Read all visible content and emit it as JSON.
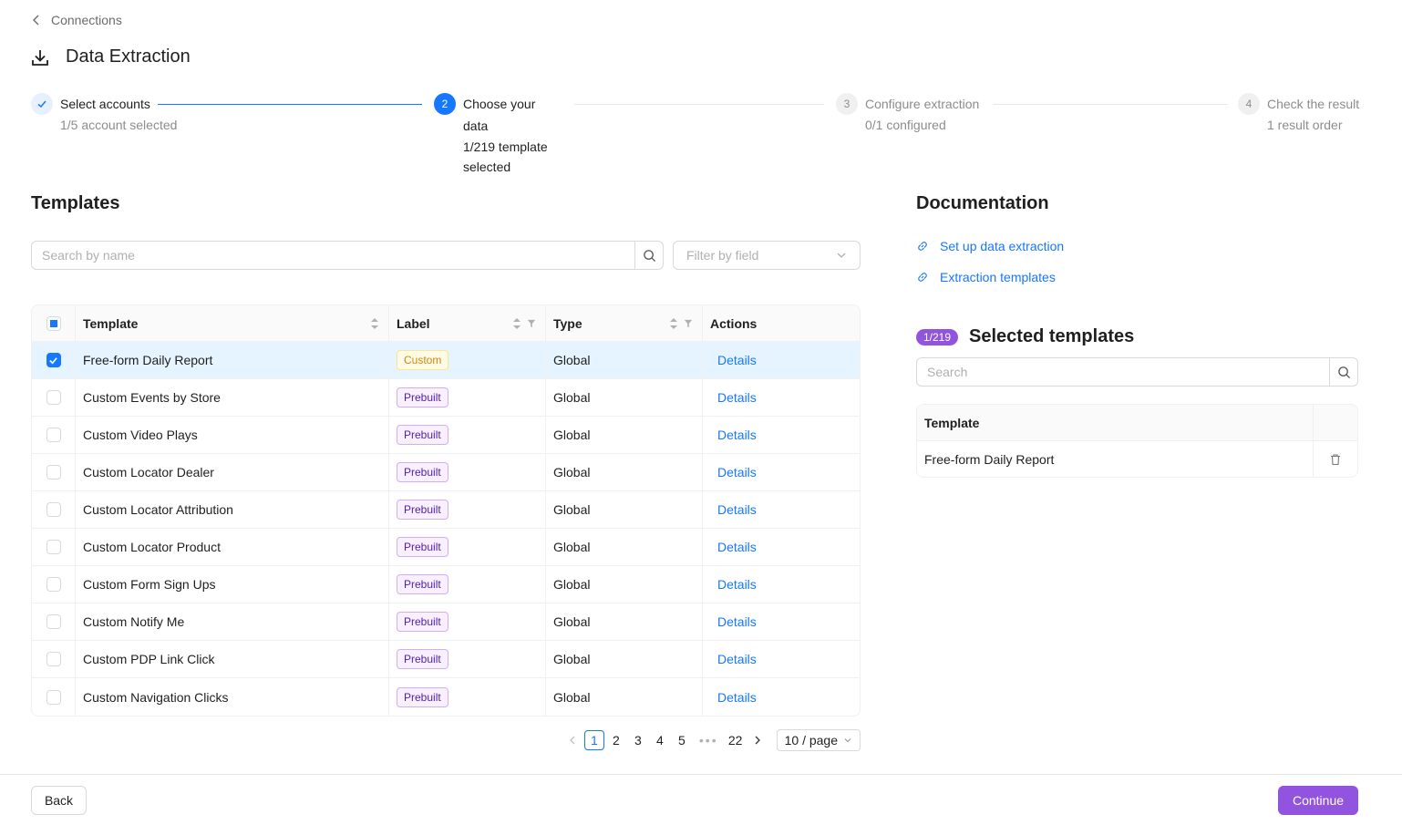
{
  "breadcrumb": {
    "back_label": "Connections"
  },
  "page": {
    "title": "Data Extraction"
  },
  "steps": [
    {
      "number": "1",
      "title": "Select accounts",
      "subtitle": "1/5 account selected",
      "status": "done"
    },
    {
      "number": "2",
      "title": "Choose your data",
      "subtitle": "1/219 template selected",
      "status": "active"
    },
    {
      "number": "3",
      "title": "Configure extraction",
      "subtitle": "0/1 configured",
      "status": "wait"
    },
    {
      "number": "4",
      "title": "Check the result",
      "subtitle": "1 result order",
      "status": "wait"
    }
  ],
  "templates": {
    "title": "Templates",
    "search_placeholder": "Search by name",
    "filter_placeholder": "Filter by field",
    "columns": {
      "template": "Template",
      "label": "Label",
      "type": "Type",
      "actions": "Actions"
    },
    "rows": [
      {
        "name": "Free-form Daily Report",
        "label": "Custom",
        "type": "Global",
        "action": "Details",
        "selected": true
      },
      {
        "name": "Custom Events by Store",
        "label": "Prebuilt",
        "type": "Global",
        "action": "Details",
        "selected": false
      },
      {
        "name": "Custom Video Plays",
        "label": "Prebuilt",
        "type": "Global",
        "action": "Details",
        "selected": false
      },
      {
        "name": "Custom Locator Dealer",
        "label": "Prebuilt",
        "type": "Global",
        "action": "Details",
        "selected": false
      },
      {
        "name": "Custom Locator Attribution",
        "label": "Prebuilt",
        "type": "Global",
        "action": "Details",
        "selected": false
      },
      {
        "name": "Custom Locator Product",
        "label": "Prebuilt",
        "type": "Global",
        "action": "Details",
        "selected": false
      },
      {
        "name": "Custom Form Sign Ups",
        "label": "Prebuilt",
        "type": "Global",
        "action": "Details",
        "selected": false
      },
      {
        "name": "Custom Notify Me",
        "label": "Prebuilt",
        "type": "Global",
        "action": "Details",
        "selected": false
      },
      {
        "name": "Custom PDP Link Click",
        "label": "Prebuilt",
        "type": "Global",
        "action": "Details",
        "selected": false
      },
      {
        "name": "Custom Navigation Clicks",
        "label": "Prebuilt",
        "type": "Global",
        "action": "Details",
        "selected": false
      }
    ],
    "pagination": {
      "pages": [
        "1",
        "2",
        "3",
        "4",
        "5"
      ],
      "ellipsis": "•••",
      "last": "22",
      "current": "1",
      "page_size": "10 / page"
    }
  },
  "documentation": {
    "title": "Documentation",
    "links": [
      "Set up data extraction",
      "Extraction templates"
    ]
  },
  "selected": {
    "badge": "1/219",
    "title": "Selected templates",
    "search_placeholder": "Search",
    "column": "Template",
    "rows": [
      "Free-form Daily Report"
    ]
  },
  "footer": {
    "back_label": "Back",
    "continue_label": "Continue"
  },
  "colors": {
    "primary": "#1677ff",
    "accent": "#9254de",
    "custom_tag": "#d48806",
    "prebuilt_tag": "#531dab"
  }
}
